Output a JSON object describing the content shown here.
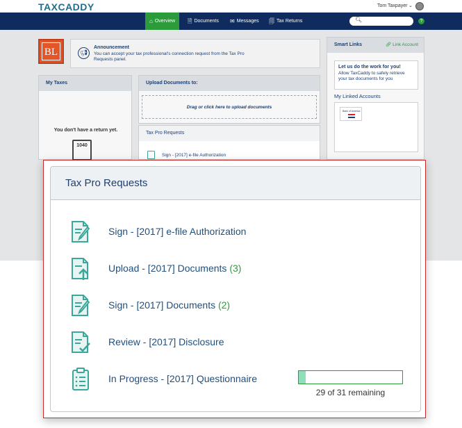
{
  "brand": {
    "logo": "TAXCADDY",
    "user_name": "Tom Taxpayer",
    "user_caret": "⌄"
  },
  "nav": {
    "items": [
      {
        "label": "Overview",
        "icon": "⌂",
        "active": true
      },
      {
        "label": "Documents",
        "icon": "🗎",
        "active": false
      },
      {
        "label": "Messages",
        "icon": "✉",
        "active": false
      },
      {
        "label": "Tax Returns",
        "icon": "🗐",
        "active": false
      }
    ],
    "search_placeholder": "",
    "help": "?"
  },
  "firm_logo": "BL",
  "announcement": {
    "title": "Announcement",
    "text": "You can accept your tax professional's connection request from the Tax Pro Requests panel."
  },
  "my_taxes": {
    "title": "My Taxes",
    "empty_text": "You don't have a return yet.",
    "form_label": "1040"
  },
  "upload_panel": {
    "title": "Upload Documents to:",
    "dropzone": "Drag or click here to upload documents"
  },
  "tax_pro_small": {
    "title": "Tax Pro Requests",
    "first_item": "Sign - [2017] e-file Authorization"
  },
  "smart_links": {
    "title": "Smart Links",
    "link_account": "Link Account",
    "promo_title": "Let us do the work for you!",
    "promo_text": "Allow TaxCaddy to safely retrieve your tax documents for you",
    "linked_title": "My Linked Accounts",
    "bank_name": "Bank of America"
  },
  "modal": {
    "title": "Tax Pro Requests",
    "requests": [
      {
        "label": "Sign - [2017] e-file Authorization",
        "count": "",
        "icon": "sign-document-icon"
      },
      {
        "label": "Upload - [2017] Documents",
        "count": "(3)",
        "icon": "upload-document-icon"
      },
      {
        "label": "Sign - [2017] Documents",
        "count": "(2)",
        "icon": "sign-document-icon"
      },
      {
        "label": "Review - [2017] Disclosure",
        "count": "",
        "icon": "review-document-icon"
      },
      {
        "label": "In Progress - [2017] Questionnaire",
        "count": "",
        "icon": "clipboard-icon",
        "progress_fraction": 0.065,
        "progress_text": "29 of 31 remaining"
      }
    ]
  },
  "colors": {
    "accent": "#2c9b3c",
    "nav": "#102c5e",
    "icon_teal": "#3aa79a",
    "text_blue": "#1f4f7e"
  }
}
